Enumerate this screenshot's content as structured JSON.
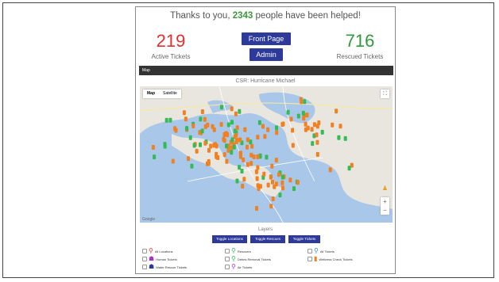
{
  "header": {
    "thanks_prefix": "Thanks to you,",
    "helped_count": "2343",
    "thanks_suffix": "people have been helped!"
  },
  "stats": {
    "active_value": "219",
    "active_label": "Active Tickets",
    "rescued_value": "716",
    "rescued_label": "Rescued Tickets"
  },
  "buttons": {
    "front_page": "Front Page",
    "admin": "Admin"
  },
  "map": {
    "bar_label": "Map",
    "title": "CSR: Hurricane Michael",
    "type_map": "Map",
    "type_satellite": "Satellite",
    "google_label": "Google"
  },
  "layers": {
    "heading": "Layers",
    "toggle_buttons": [
      "Toggle Locations",
      "Toggle Rescues",
      "Toggle Tickets"
    ],
    "legend": [
      {
        "label": "All Locations",
        "icon": "location-pin-icon",
        "color": "#e03030"
      },
      {
        "label": "Rescuers",
        "icon": "location-pin-icon",
        "color": "#33bb55"
      },
      {
        "label": "All Tickets",
        "icon": "location-pin-icon",
        "color": "#3388dd"
      },
      {
        "label": "Human Tickets",
        "icon": "person-icon",
        "color": "#aa33cc"
      },
      {
        "label": "Debris Removal Tickets",
        "icon": "debris-icon",
        "color": "#33bb55"
      },
      {
        "label": "Wellness Check Tickets",
        "icon": "wellness-icon",
        "color": "#f08020"
      },
      {
        "label": "Water Rescue Tickets",
        "icon": "boat-icon",
        "color": "#2d3a9c"
      },
      {
        "label": "Air Tickets",
        "icon": "location-pin-icon",
        "color": "#9933cc"
      }
    ]
  },
  "colors": {
    "button": "#2d3a9c",
    "active": "#e03030",
    "rescued": "#2e9a3a",
    "water": "#a9c7e8",
    "land": "#e9e6df",
    "marker_orange": "#f08020",
    "marker_green": "#33bb55"
  }
}
